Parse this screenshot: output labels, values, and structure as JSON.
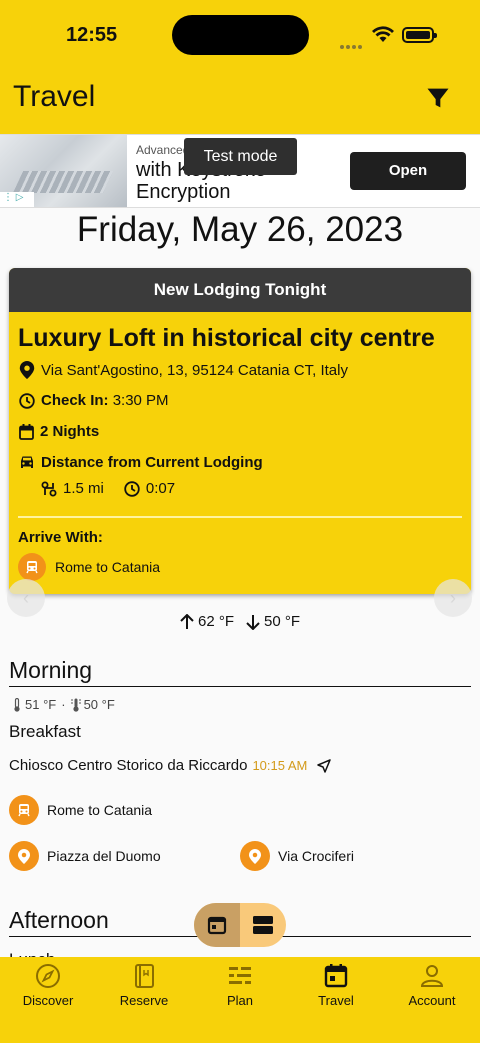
{
  "status": {
    "time": "12:55"
  },
  "header": {
    "title": "Travel",
    "filter_icon": "filter-icon"
  },
  "ad": {
    "small": "Advanced",
    "headline_1": "with Keystroke",
    "headline_2": "Encryption",
    "tooltip": "Test mode",
    "open_label": "Open"
  },
  "date": "Friday, May 26, 2023",
  "lodging": {
    "header": "New Lodging Tonight",
    "name": "Luxury Loft in historical city centre",
    "address": "Via Sant'Agostino, 13, 95124 Catania CT, Italy",
    "check_in_label": "Check In:",
    "check_in_time": "3:30 PM",
    "nights": "2 Nights",
    "distance_label": "Distance from Current Lodging",
    "distance": "1.5 mi",
    "duration": "0:07",
    "arrive_label": "Arrive With:",
    "arrive_with": "Rome to Catania",
    "accent_color": "#f7d20a"
  },
  "temps": {
    "high": "62 °F",
    "low": "50 °F"
  },
  "morning": {
    "title": "Morning",
    "high": "51 °F",
    "low": "50 °F",
    "meal": "Breakfast",
    "place": "Chiosco Centro Storico da Riccardo",
    "time": "10:15 AM",
    "chip_transport": "Rome to Catania",
    "chip_place_1": "Piazza del Duomo",
    "chip_place_2": "Via Crociferi"
  },
  "afternoon": {
    "title": "Afternoon",
    "meal": "Lunch"
  },
  "tabs": [
    {
      "label": "Discover",
      "icon": "compass-icon"
    },
    {
      "label": "Reserve",
      "icon": "book-icon"
    },
    {
      "label": "Plan",
      "icon": "list-icon"
    },
    {
      "label": "Travel",
      "icon": "calendar-icon"
    },
    {
      "label": "Account",
      "icon": "person-icon"
    }
  ]
}
